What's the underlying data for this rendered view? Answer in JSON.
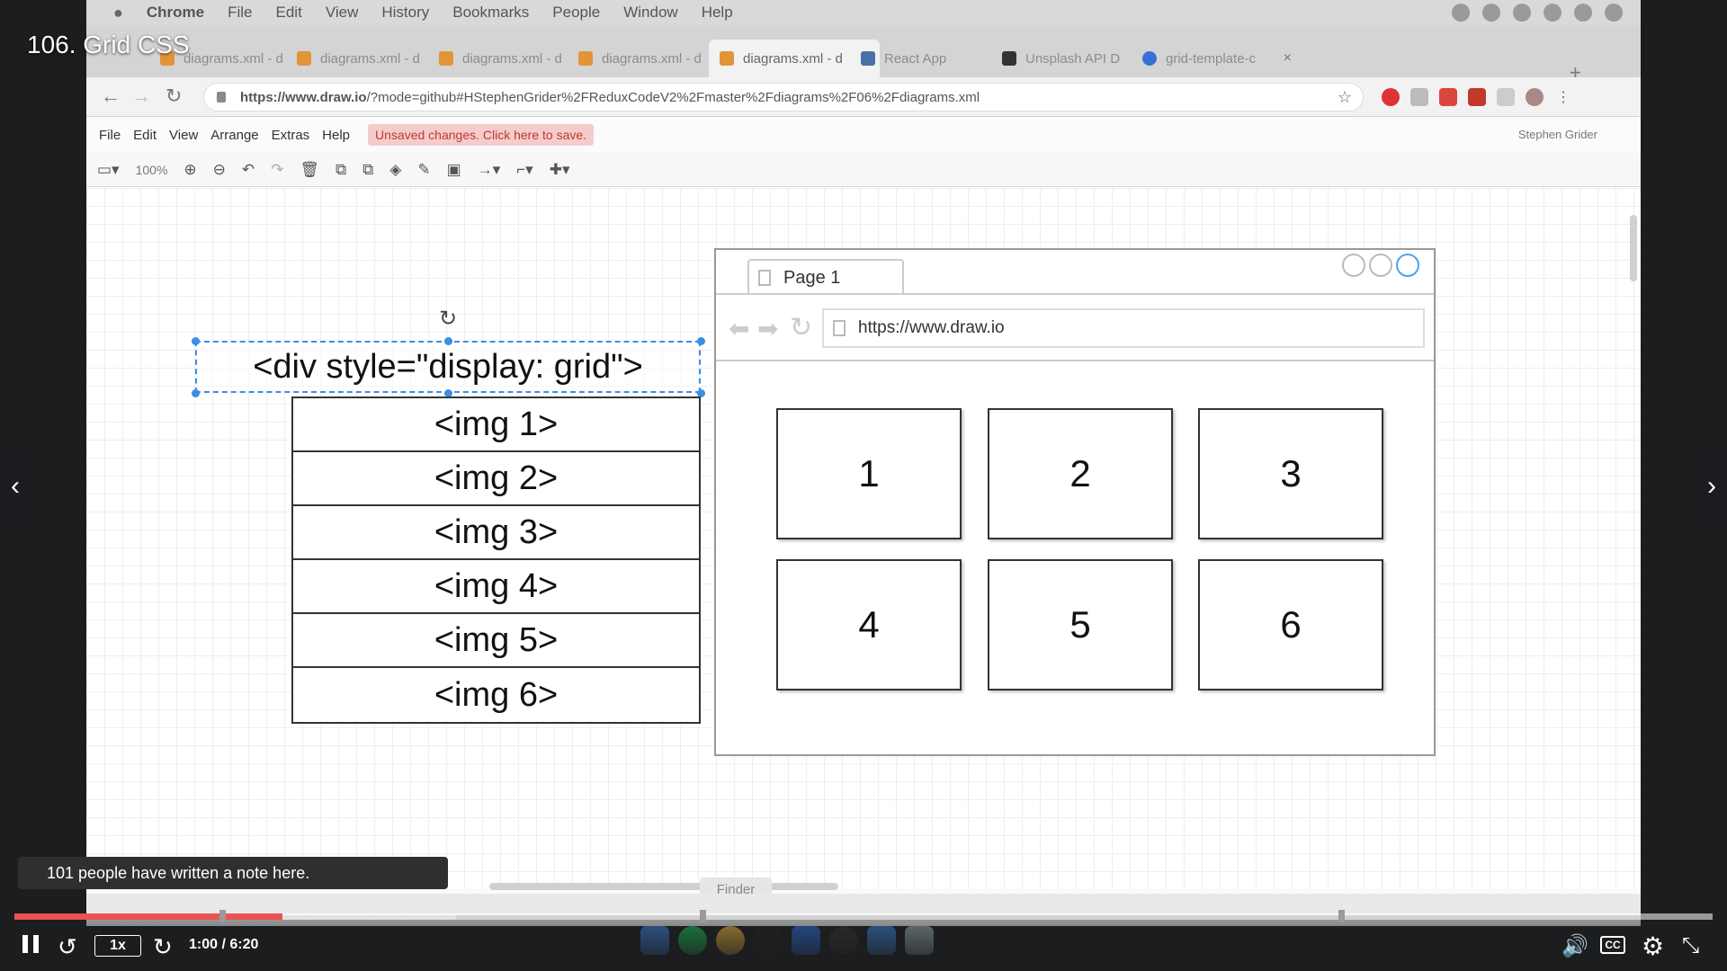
{
  "lecture": {
    "title": "106. Grid CSS",
    "notes_toast": "101 people have written a note here."
  },
  "player": {
    "time": "1:00 / 6:20",
    "progress_fraction": 0.158,
    "buffered_fraction": 0.26,
    "speed": "1x",
    "icons": {
      "pause": "pause-icon",
      "rewind": "rewind-5s-icon",
      "forward": "forward-5s-icon",
      "volume": "volume-icon",
      "captions": "closed-captions-icon",
      "settings": "gear-icon",
      "fullscreen": "exit-fullscreen-icon",
      "prev": "chevron-left-icon",
      "next": "chevron-right-icon"
    },
    "cc_label": "CC",
    "accent_color": "#ec5252"
  },
  "mac_menubar": {
    "items": [
      "Chrome",
      "File",
      "Edit",
      "View",
      "History",
      "Bookmarks",
      "People",
      "Window",
      "Help"
    ]
  },
  "chrome": {
    "tabs": [
      {
        "label": "diagrams.xml - d",
        "active": false
      },
      {
        "label": "diagrams.xml - d",
        "active": false
      },
      {
        "label": "diagrams.xml - d",
        "active": false
      },
      {
        "label": "diagrams.xml - d",
        "active": false
      },
      {
        "label": "diagrams.xml - d",
        "active": true
      },
      {
        "label": "React App",
        "active": false
      },
      {
        "label": "Unsplash API D",
        "active": false
      },
      {
        "label": "grid-template-c",
        "active": false
      }
    ],
    "url_host": "https://www.draw.io",
    "url_rest": "/?mode=github#HStephenGrider%2FReduxCodeV2%2Fmaster%2Fdiagrams%2F06%2Fdiagrams.xml"
  },
  "drawio": {
    "menu": [
      "File",
      "Edit",
      "View",
      "Arrange",
      "Extras",
      "Help"
    ],
    "unsaved": "Unsaved changes. Click here to save.",
    "user": "Stephen Grider",
    "zoom": "100%",
    "finder_tooltip": "Finder"
  },
  "diagram": {
    "container_label": "<div style=\"display: grid\">",
    "img_items": [
      "<img 1>",
      "<img 2>",
      "<img 3>",
      "<img 4>",
      "<img 5>",
      "<img 6>"
    ],
    "mock_browser": {
      "tab_label": "Page 1",
      "url": "https://www.draw.io",
      "cells": [
        "1",
        "2",
        "3",
        "4",
        "5",
        "6"
      ]
    }
  }
}
